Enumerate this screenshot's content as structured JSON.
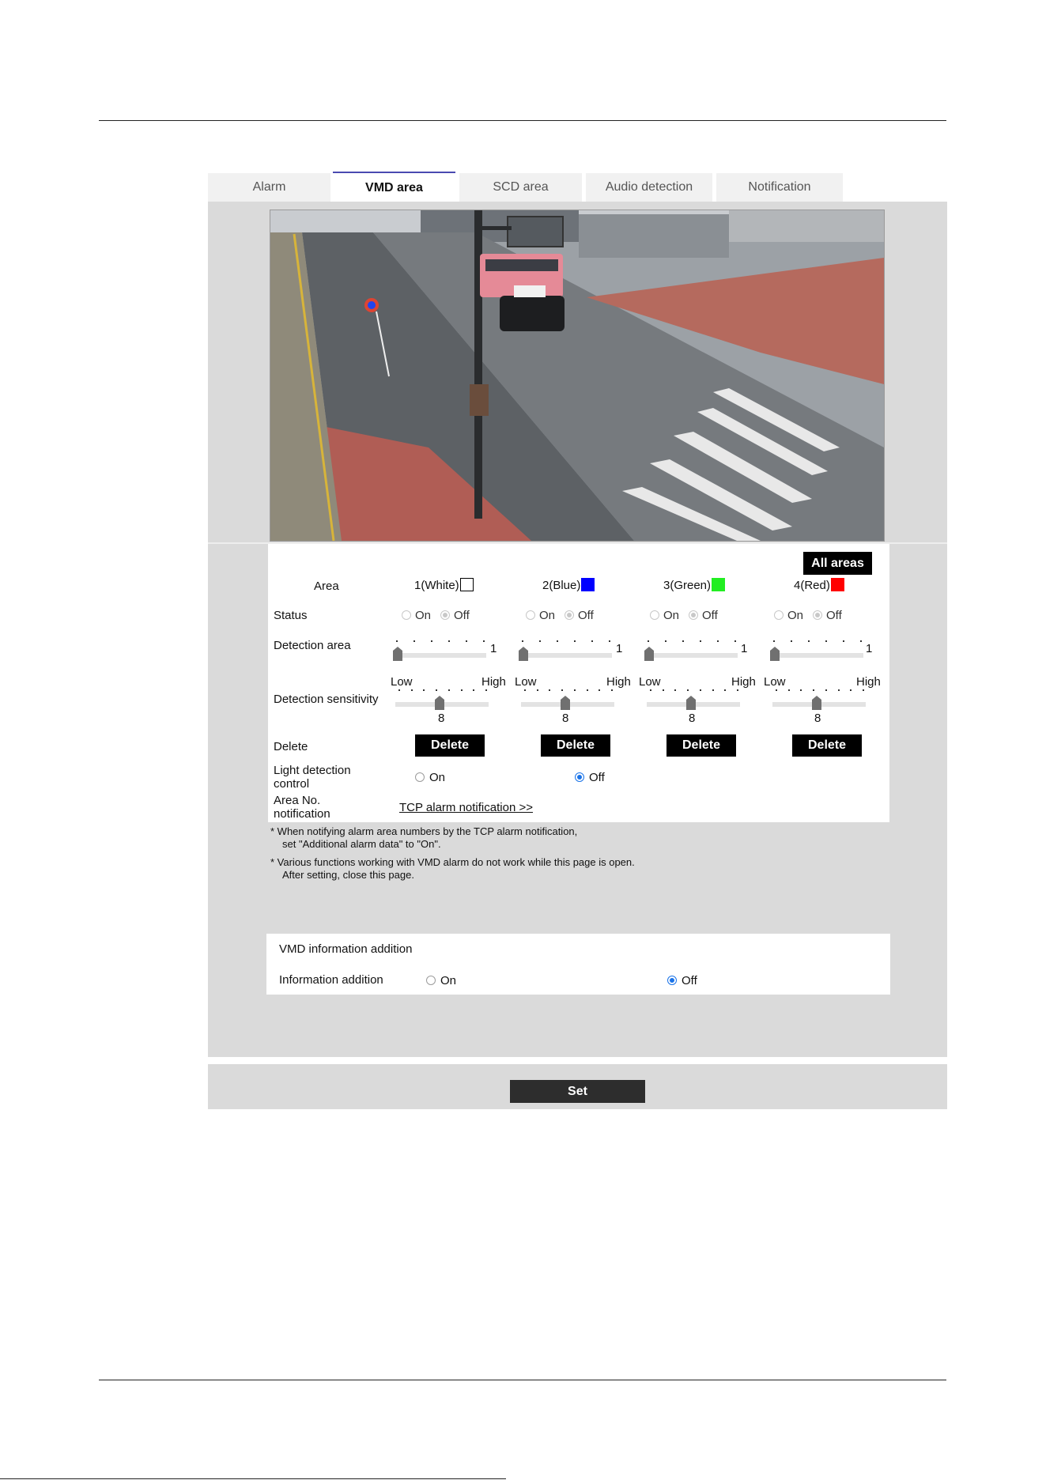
{
  "tabs": [
    {
      "label": "Alarm",
      "active": false
    },
    {
      "label": "VMD area",
      "active": true
    },
    {
      "label": "SCD area",
      "active": false
    },
    {
      "label": "Audio detection",
      "active": false
    },
    {
      "label": "Notification",
      "active": false
    }
  ],
  "all_areas_label": "All areas",
  "row_labels": {
    "area": "Area",
    "status": "Status",
    "detection_area": "Detection area",
    "detection_sensitivity": "Detection sensitivity",
    "delete": "Delete",
    "light_detection_control_line1": "Light detection",
    "light_detection_control_line2": "control",
    "area_no_notification_line1": "Area No.",
    "area_no_notification_line2": "notification"
  },
  "areas": [
    {
      "label": "1(White)",
      "color": "#ffffff",
      "status": "Off",
      "detection_area": "1",
      "sensitivity": "8"
    },
    {
      "label": "2(Blue)",
      "color": "#0000ff",
      "status": "Off",
      "detection_area": "1",
      "sensitivity": "8"
    },
    {
      "label": "3(Green)",
      "color": "#22ee22",
      "status": "Off",
      "detection_area": "1",
      "sensitivity": "8"
    },
    {
      "label": "4(Red)",
      "color": "#ff0000",
      "status": "Off",
      "detection_area": "1",
      "sensitivity": "8"
    }
  ],
  "radio_on": "On",
  "radio_off": "Off",
  "sensitivity_low": "Low",
  "sensitivity_high": "High",
  "delete_button": "Delete",
  "light_detection_control": "Off",
  "tcp_link": "TCP alarm notification >>",
  "notes": [
    {
      "line1": "* When notifying alarm area numbers by the TCP alarm notification,",
      "line2": "set \"Additional alarm data\" to \"On\"."
    },
    {
      "line1": "* Various functions working with VMD alarm do not work while this page is open.",
      "line2": "After setting, close this page."
    }
  ],
  "vmd_info": {
    "title": "VMD information addition",
    "label": "Information addition",
    "value": "Off"
  },
  "set_button": "Set"
}
